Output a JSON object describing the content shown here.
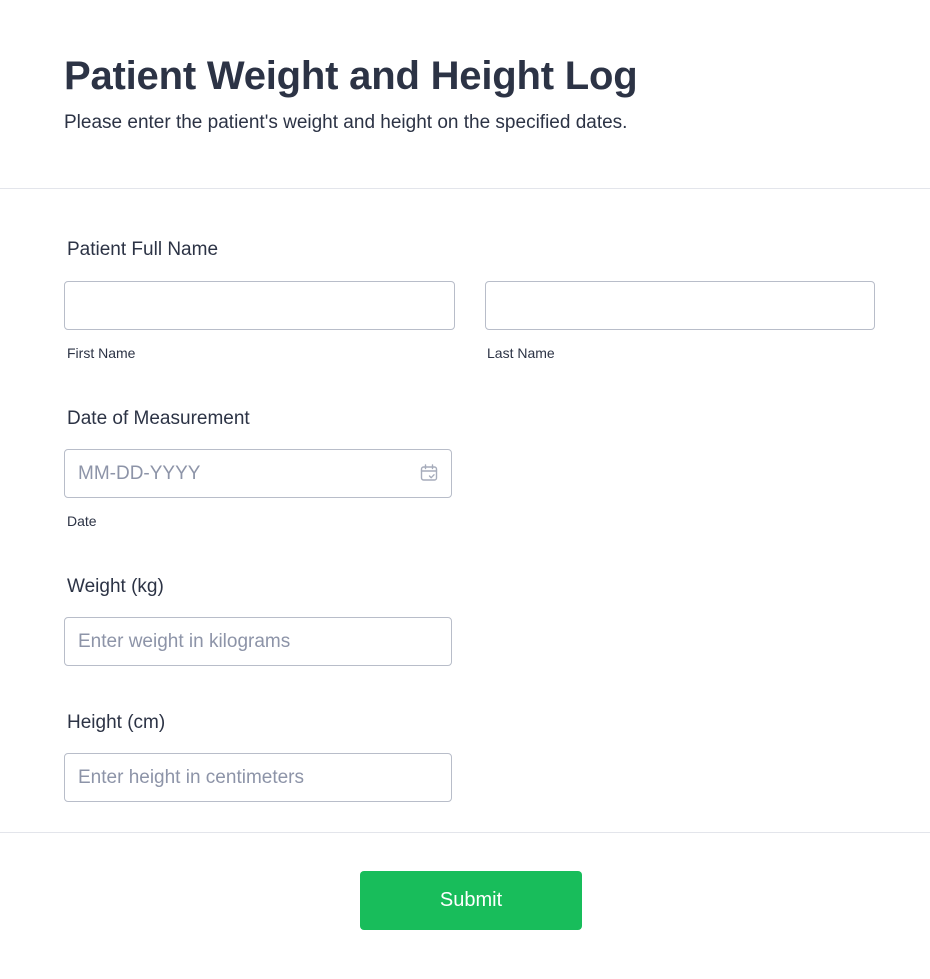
{
  "header": {
    "title": "Patient Weight and Height Log",
    "subtitle": "Please enter the patient's weight and height on the specified dates."
  },
  "form": {
    "patient_name": {
      "label": "Patient Full Name",
      "first_name": {
        "value": "",
        "placeholder": "",
        "sublabel": "First Name"
      },
      "last_name": {
        "value": "",
        "placeholder": "",
        "sublabel": "Last Name"
      }
    },
    "date": {
      "label": "Date of Measurement",
      "value": "",
      "placeholder": "MM-DD-YYYY",
      "sublabel": "Date",
      "icon": "calendar-icon"
    },
    "weight": {
      "label": "Weight (kg)",
      "value": "",
      "placeholder": "Enter weight in kilograms"
    },
    "height": {
      "label": "Height (cm)",
      "value": "",
      "placeholder": "Enter height in centimeters"
    }
  },
  "actions": {
    "submit_label": "Submit"
  },
  "colors": {
    "text": "#2c3345",
    "placeholder": "#8d94a8",
    "border": "#b8bdc9",
    "divider": "#e3e5eb",
    "submit_bg": "#18bd5b",
    "submit_text": "#ffffff"
  }
}
